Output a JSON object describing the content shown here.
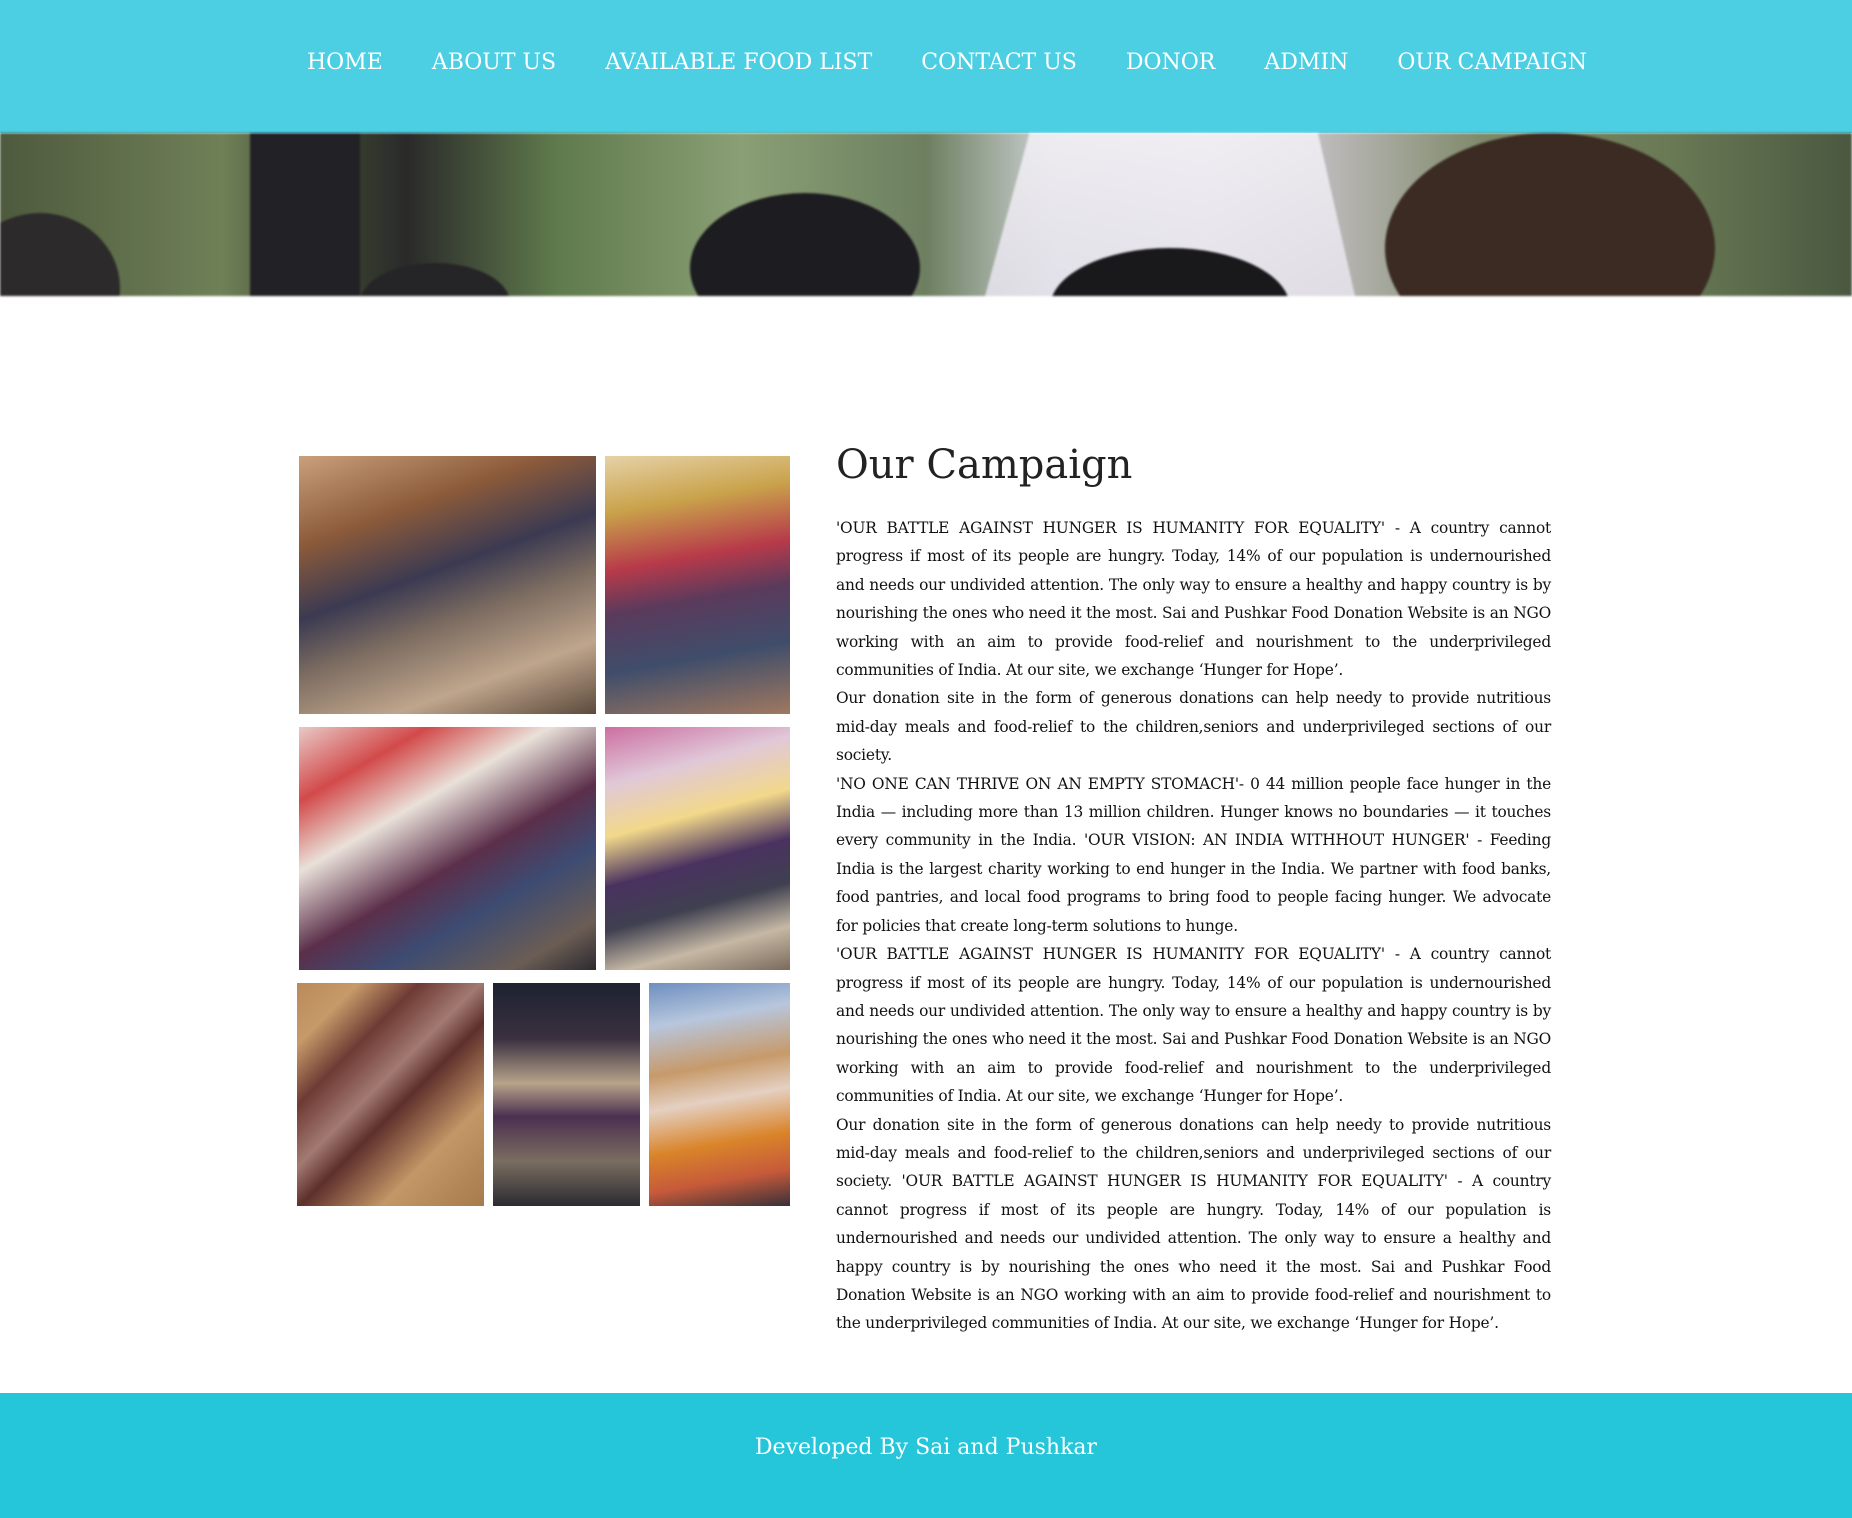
{
  "nav": {
    "items": [
      {
        "label": "HOME"
      },
      {
        "label": "ABOUT US"
      },
      {
        "label": "AVAILABLE FOOD LIST"
      },
      {
        "label": "CONTACT US"
      },
      {
        "label": "DONOR"
      },
      {
        "label": "ADMIN"
      },
      {
        "label": "OUR CAMPAIGN"
      }
    ]
  },
  "campaign": {
    "title": "Our Campaign",
    "paragraphs": [
      "'OUR BATTLE AGAINST HUNGER IS HUMANITY FOR EQUALITY' - A country cannot progress if most of its people are hungry. Today, 14% of our population is undernourished and needs our undivided attention. The only way to ensure a healthy and happy country is by nourishing the ones who need it the most. Sai and Pushkar Food Donation Website is an NGO working with an aim to provide food-relief and nourishment to the underprivileged communities of India. At our site, we exchange ‘Hunger for Hope’.",
      "Our donation site in the form of generous donations can help needy to provide nutritious mid-day meals and food-relief to the children,seniors and underprivileged sections of our society.",
      "'NO ONE CAN THRIVE ON AN EMPTY STOMACH'- 0 44 million people face hunger in the India — including more than 13 million children. Hunger knows no boundaries — it touches every community in the India. 'OUR VISION: AN INDIA WITHHOUT HUNGER' - Feeding India is the largest charity working to end hunger in the India. We partner with food banks, food pantries, and local food programs to bring food to people facing hunger. We advocate for policies that create long-term solutions to hunge.",
      "'OUR BATTLE AGAINST HUNGER IS HUMANITY FOR EQUALITY' - A country cannot progress if most of its people are hungry. Today, 14% of our population is undernourished and needs our undivided attention. The only way to ensure a healthy and happy country is by nourishing the ones who need it the most. Sai and Pushkar Food Donation Website is an NGO working with an aim to provide food-relief and nourishment to the underprivileged communities of India. At our site, we exchange ‘Hunger for Hope’.",
      "Our donation site in the form of generous donations can help needy to provide nutritious mid-day meals and food-relief to the children,seniors and underprivileged sections of our society. 'OUR BATTLE AGAINST HUNGER IS HUMANITY FOR EQUALITY' - A country cannot progress if most of its people are hungry. Today, 14% of our population is undernourished and needs our undivided attention. The only way to ensure a healthy and happy country is by nourishing the ones who need it the most. Sai and Pushkar Food Donation Website is an NGO working with an aim to provide food-relief and nourishment to the underprivileged communities of India. At our site, we exchange ‘Hunger for Hope’."
    ]
  },
  "footer": {
    "text": "Developed By Sai and Pushkar"
  },
  "colors": {
    "nav_bg": "#4ccfe3",
    "footer_bg": "#25c6da",
    "text": "#111111"
  }
}
